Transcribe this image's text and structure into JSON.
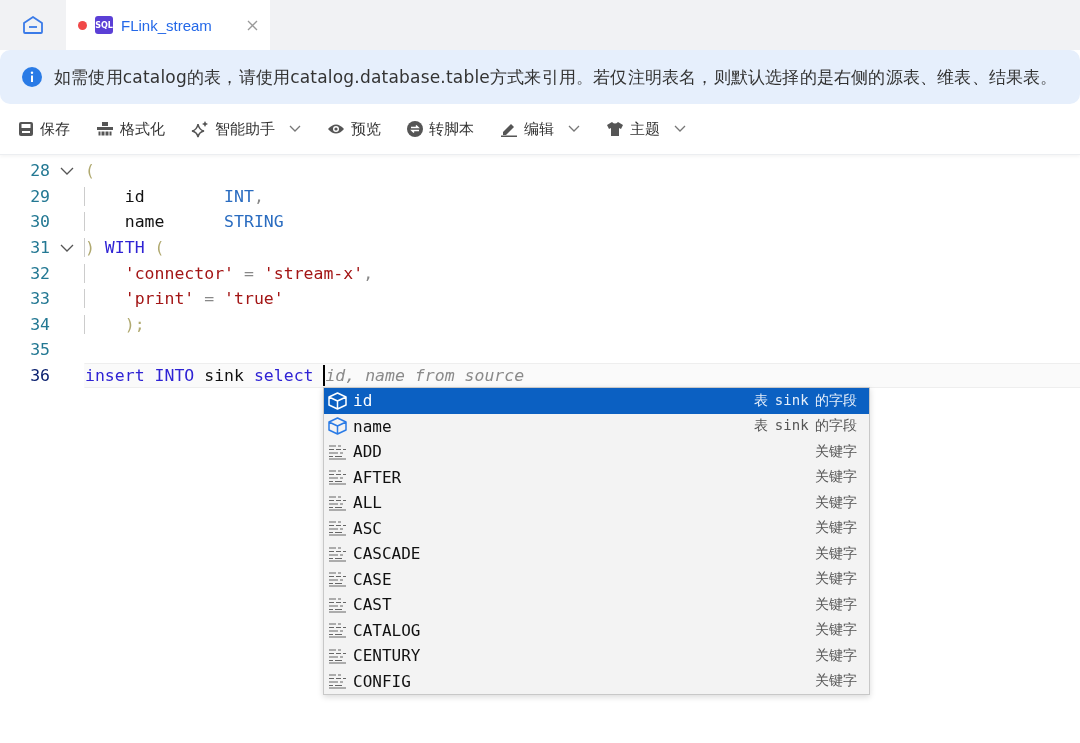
{
  "tabs": [
    {
      "kind": "home",
      "selected": false
    },
    {
      "kind": "file",
      "badge": "SQL",
      "title": "FLink_stream",
      "modified": true,
      "selected": true
    }
  ],
  "notice": "如需使用catalog的表，请使用catalog.database.table方式来引用。若仅注明表名，则默认选择的是右侧的源表、维表、结果表。",
  "toolbar": [
    {
      "label": "保存",
      "dropdown": false
    },
    {
      "label": "格式化",
      "dropdown": false
    },
    {
      "label": "智能助手",
      "dropdown": true
    },
    {
      "label": "预览",
      "dropdown": false
    },
    {
      "label": "转脚本",
      "dropdown": false
    },
    {
      "label": "编辑",
      "dropdown": true
    },
    {
      "label": "主题",
      "dropdown": true
    }
  ],
  "editor": {
    "lines": [
      {
        "number": "28",
        "foldable": true,
        "current": false,
        "tokens": [
          {
            "text": "(",
            "kind": "paren"
          }
        ]
      },
      {
        "number": "29",
        "foldable": false,
        "current": false,
        "tokens": [
          {
            "text": "    id        ",
            "kind": "ident"
          },
          {
            "text": "INT",
            "kind": "type"
          },
          {
            "text": ",",
            "kind": "punct"
          }
        ]
      },
      {
        "number": "30",
        "foldable": false,
        "current": false,
        "tokens": [
          {
            "text": "    name      ",
            "kind": "ident"
          },
          {
            "text": "STRING",
            "kind": "type"
          }
        ]
      },
      {
        "number": "31",
        "foldable": true,
        "current": false,
        "tokens": [
          {
            "text": ")",
            "kind": "paren"
          },
          {
            "text": " WITH ",
            "kind": "keyword"
          },
          {
            "text": "(",
            "kind": "paren"
          }
        ]
      },
      {
        "number": "32",
        "foldable": false,
        "current": false,
        "tokens": [
          {
            "text": "    'connector'",
            "kind": "string"
          },
          {
            "text": " = ",
            "kind": "punct"
          },
          {
            "text": "'stream-x'",
            "kind": "string"
          },
          {
            "text": ",",
            "kind": "punct"
          }
        ]
      },
      {
        "number": "33",
        "foldable": false,
        "current": false,
        "tokens": [
          {
            "text": "    'print'",
            "kind": "string"
          },
          {
            "text": " = ",
            "kind": "punct"
          },
          {
            "text": "'true'",
            "kind": "string"
          }
        ]
      },
      {
        "number": "34",
        "foldable": false,
        "current": false,
        "tokens": [
          {
            "text": "    );",
            "kind": "paren"
          }
        ]
      },
      {
        "number": "35",
        "foldable": false,
        "current": false
      },
      {
        "number": "36",
        "foldable": false,
        "current": true,
        "tokens": [
          {
            "text": "insert ",
            "kind": "keyword"
          },
          {
            "text": "INTO ",
            "kind": "keyword"
          },
          {
            "text": "sink ",
            "kind": "ident"
          },
          {
            "text": "select ",
            "kind": "keyword"
          },
          {
            "text": "id, name from source",
            "kind": "ghost"
          }
        ]
      }
    ]
  },
  "suggestions": [
    {
      "kind": "field",
      "label": "id",
      "detail": "表 sink 的字段",
      "selected": true
    },
    {
      "kind": "field",
      "label": "name",
      "detail": "表 sink 的字段",
      "selected": false
    },
    {
      "kind": "keyword",
      "label": "ADD",
      "detail": "关键字",
      "selected": false
    },
    {
      "kind": "keyword",
      "label": "AFTER",
      "detail": "关键字",
      "selected": false
    },
    {
      "kind": "keyword",
      "label": "ALL",
      "detail": "关键字",
      "selected": false
    },
    {
      "kind": "keyword",
      "label": "ASC",
      "detail": "关键字",
      "selected": false
    },
    {
      "kind": "keyword",
      "label": "CASCADE",
      "detail": "关键字",
      "selected": false
    },
    {
      "kind": "keyword",
      "label": "CASE",
      "detail": "关键字",
      "selected": false
    },
    {
      "kind": "keyword",
      "label": "CAST",
      "detail": "关键字",
      "selected": false
    },
    {
      "kind": "keyword",
      "label": "CATALOG",
      "detail": "关键字",
      "selected": false
    },
    {
      "kind": "keyword",
      "label": "CENTURY",
      "detail": "关键字",
      "selected": false
    },
    {
      "kind": "keyword",
      "label": "CONFIG",
      "detail": "关键字",
      "selected": false
    }
  ]
}
